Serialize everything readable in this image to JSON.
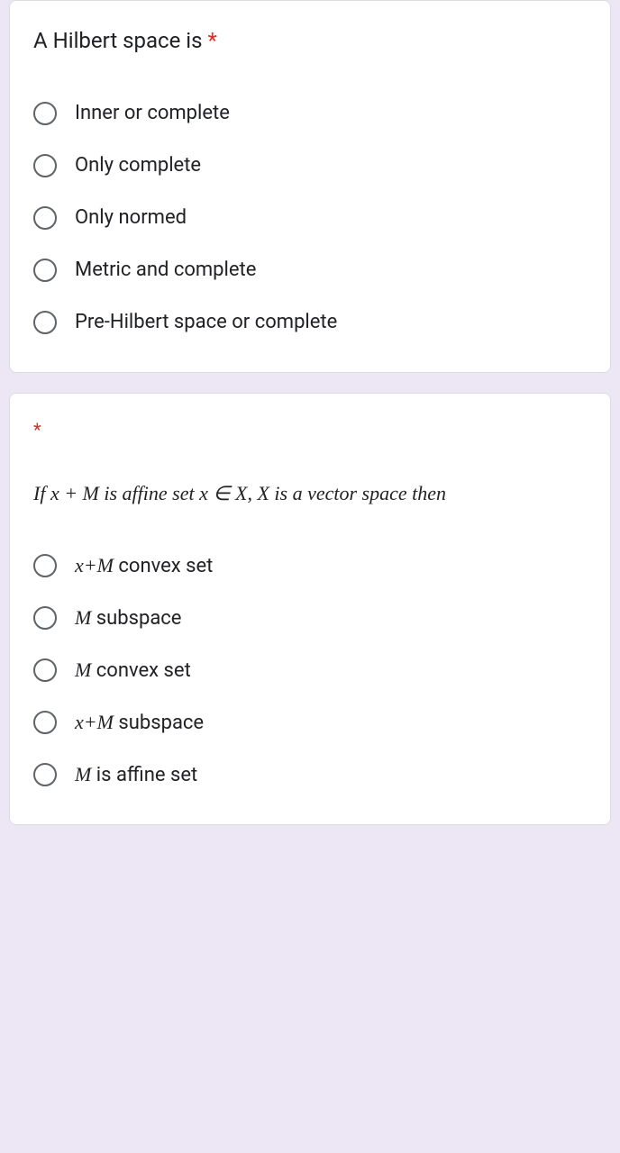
{
  "questions": [
    {
      "title": "A Hilbert space is",
      "required": "*",
      "subtext": "",
      "options": [
        {
          "plain": "Inner or complete"
        },
        {
          "plain": "Only complete"
        },
        {
          "plain": "Only normed"
        },
        {
          "plain": "Metric and complete"
        },
        {
          "plain": "Pre-Hilbert space or complete"
        }
      ]
    },
    {
      "title": "",
      "required": "*",
      "subtext": "If x + M is affine set  x ∈ X, X is a vector space then",
      "options": [
        {
          "mi": "x+M",
          "rest": " convex set"
        },
        {
          "mi": "M",
          "rest": " subspace"
        },
        {
          "mi": "M",
          "rest": " convex set"
        },
        {
          "mi": "x+M",
          "rest": " subspace"
        },
        {
          "mi": "M",
          "rest": " is affine set"
        }
      ]
    }
  ]
}
